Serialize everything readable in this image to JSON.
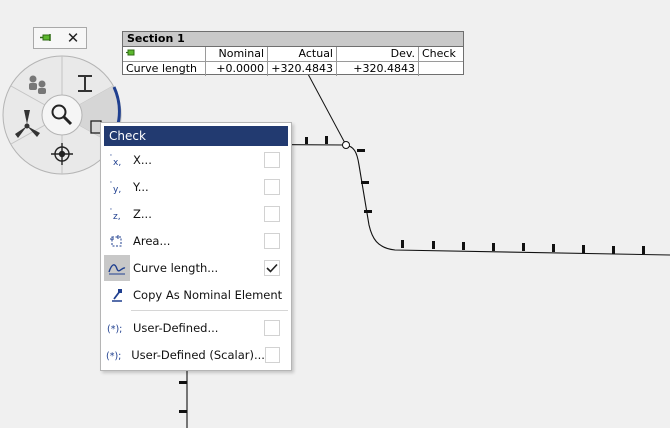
{
  "mini_toolbar": {
    "pin_icon": "pin-icon",
    "close_glyph": "✕"
  },
  "label": {
    "title": "Section 1",
    "headers": [
      "",
      "Nominal",
      "Actual",
      "Dev.",
      "Check"
    ],
    "row": [
      "Curve length",
      "+0.0000",
      "+320.4843",
      "+320.4843",
      ""
    ]
  },
  "pie_menu": {
    "tools": [
      "search-zoom-icon",
      "text-cursor-icon",
      "inspection-group-icon",
      "propeller-icon",
      "crosshair-icon",
      "check-icon"
    ]
  },
  "menu": {
    "header": "Check",
    "items": [
      {
        "label": "X...",
        "icon": "x-deviation-icon",
        "checked": false
      },
      {
        "label": "Y...",
        "icon": "y-deviation-icon",
        "checked": false
      },
      {
        "label": "Z...",
        "icon": "z-deviation-icon",
        "checked": false
      },
      {
        "label": "Area...",
        "icon": "area-icon",
        "checked": false
      },
      {
        "label": "Curve length...",
        "icon": "curve-length-icon",
        "checked": true
      },
      {
        "label": "Copy As Nominal Element",
        "icon": "copy-nominal-icon",
        "checked": null
      },
      {
        "label": "User-Defined...",
        "icon": "user-defined-icon",
        "checked": false
      },
      {
        "label": "User-Defined (Scalar)...",
        "icon": "user-defined-scalar-icon",
        "checked": false
      }
    ]
  },
  "colors": {
    "menu_header": "#223a70",
    "accent_arc": "#1f3f8f",
    "background": "#f0f0f0"
  }
}
